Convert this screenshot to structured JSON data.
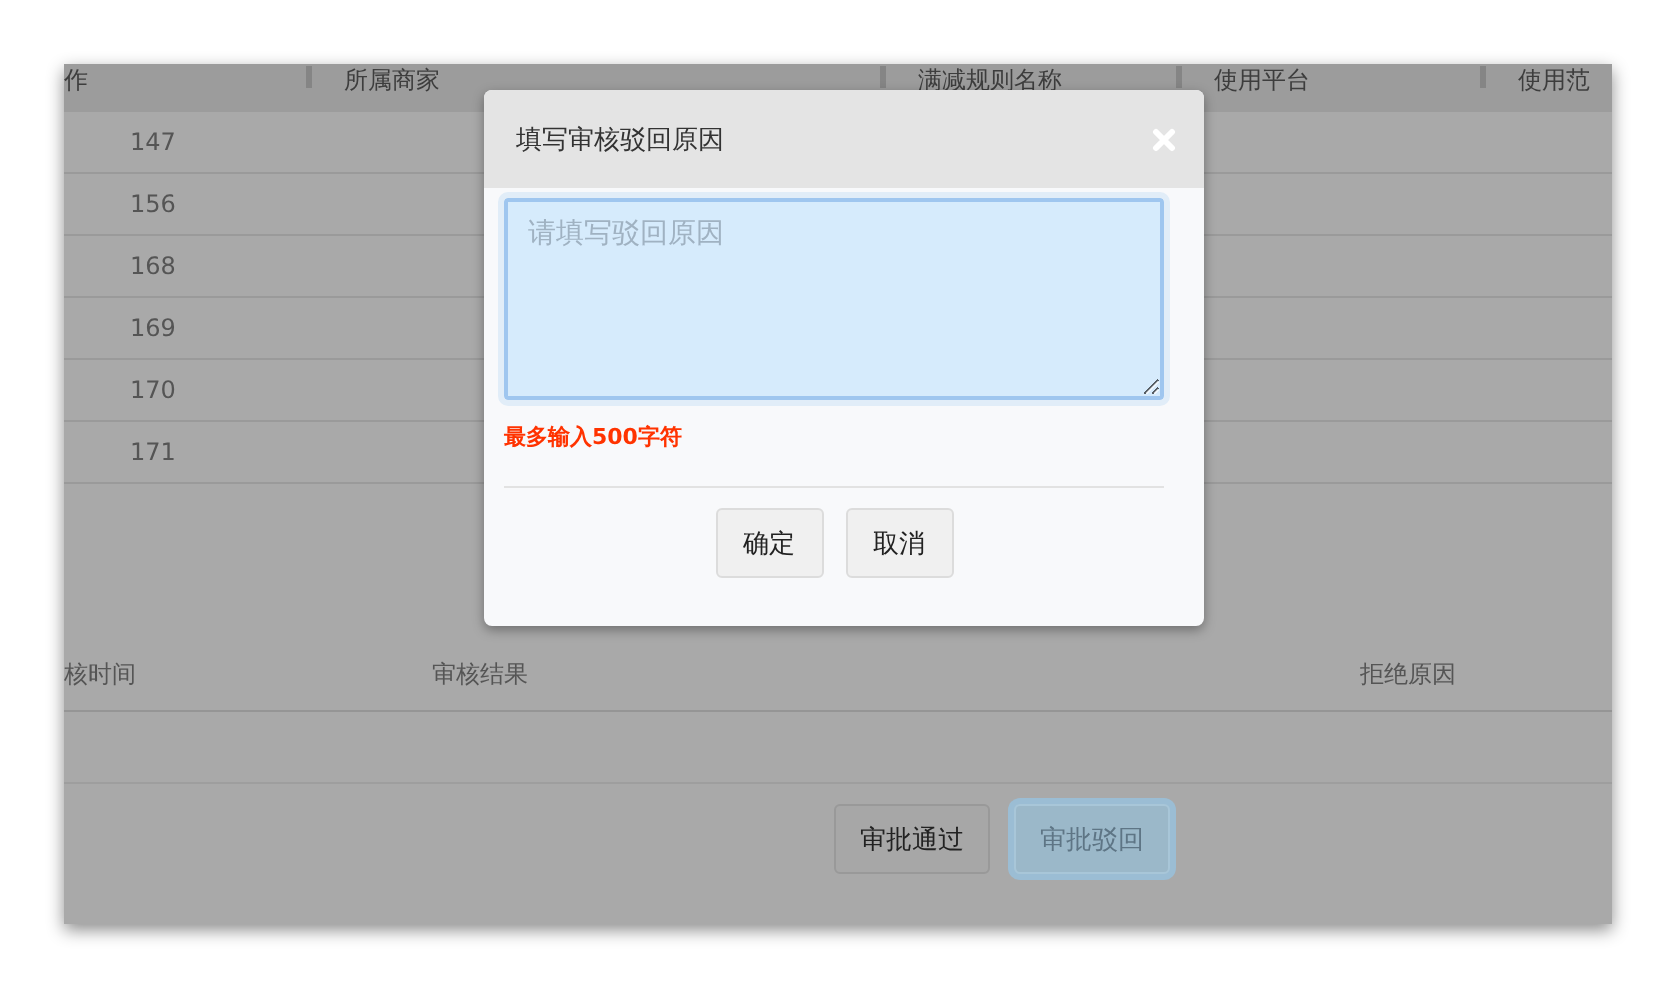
{
  "table": {
    "columns": [
      "作",
      "所属商家",
      "满减规则名称",
      "使用平台",
      "使用范"
    ],
    "rows": [
      [
        "147"
      ],
      [
        "156"
      ],
      [
        "168"
      ],
      [
        "169"
      ],
      [
        "170"
      ],
      [
        "171"
      ]
    ]
  },
  "review_table": {
    "columns": [
      "核时间",
      "审核结果",
      "拒绝原因"
    ]
  },
  "actions": [
    {
      "label": "审批通过",
      "focused": false
    },
    {
      "label": "审批驳回",
      "focused": true
    }
  ],
  "dialog": {
    "title": "填写审核驳回原因",
    "reason_field": {
      "placeholder": "请填写驳回原因"
    },
    "hint": "最多输入500字符",
    "buttons": [
      "确定",
      "取消"
    ]
  }
}
